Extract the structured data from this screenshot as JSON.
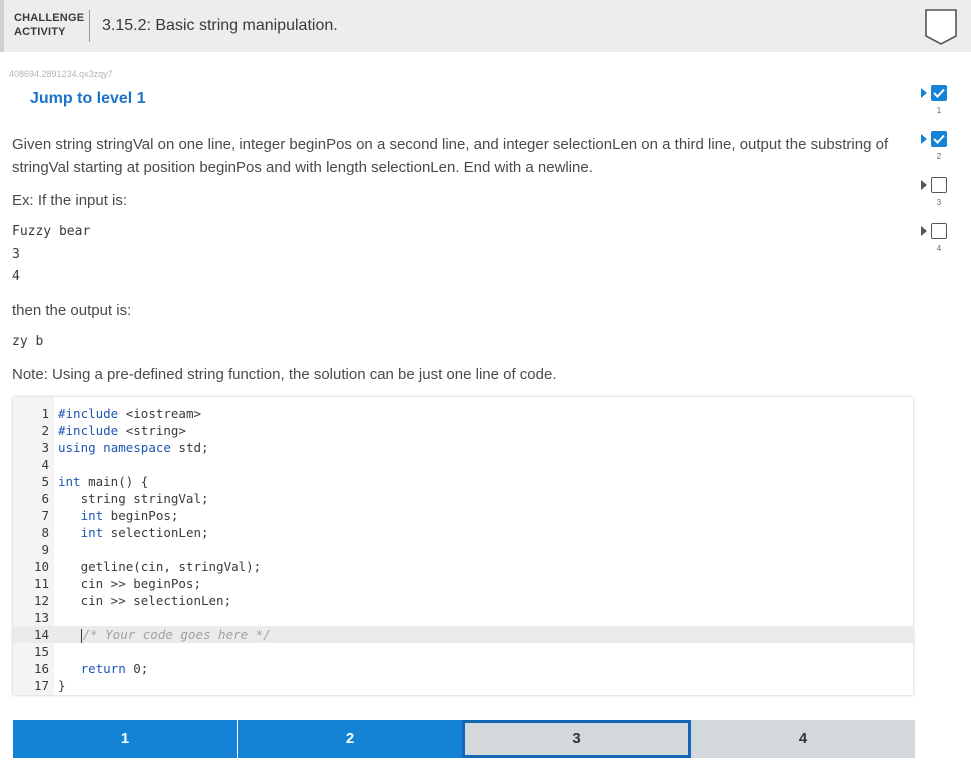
{
  "header": {
    "label_line1": "CHALLENGE",
    "label_line2": "ACTIVITY",
    "title": "3.15.2: Basic string manipulation."
  },
  "activity_id": "408694.2891234.qx3zqy7",
  "jump_link": "Jump to level 1",
  "instructions": {
    "description": "Given string stringVal on one line, integer beginPos on a second line, and integer selectionLen on a third line, output the substring of stringVal starting at position beginPos and with length selectionLen. End with a newline.",
    "example_intro": "Ex: If the input is:",
    "input_lines": [
      "Fuzzy bear",
      "3",
      "4"
    ],
    "output_intro": "then the output is:",
    "output_line": "zy b",
    "note": "Note: Using a pre-defined string function, the solution can be just one line of code."
  },
  "code": {
    "lines": [
      {
        "n": "1",
        "t": "#include <iostream>"
      },
      {
        "n": "2",
        "t": "#include <string>"
      },
      {
        "n": "3",
        "t": "using namespace std;"
      },
      {
        "n": "4",
        "t": ""
      },
      {
        "n": "5",
        "t": "int main() {"
      },
      {
        "n": "6",
        "t": "   string stringVal;"
      },
      {
        "n": "7",
        "t": "   int beginPos;"
      },
      {
        "n": "8",
        "t": "   int selectionLen;"
      },
      {
        "n": "9",
        "t": ""
      },
      {
        "n": "10",
        "t": "   getline(cin, stringVal);"
      },
      {
        "n": "11",
        "t": "   cin >> beginPos;"
      },
      {
        "n": "12",
        "t": "   cin >> selectionLen;"
      },
      {
        "n": "13",
        "t": ""
      },
      {
        "n": "14",
        "t": "   /* Your code goes here */"
      },
      {
        "n": "15",
        "t": ""
      },
      {
        "n": "16",
        "t": "   return 0;"
      },
      {
        "n": "17",
        "t": "}"
      }
    ]
  },
  "levels": {
    "bar": [
      {
        "label": "1",
        "state": "done"
      },
      {
        "label": "2",
        "state": "done"
      },
      {
        "label": "3",
        "state": "current"
      },
      {
        "label": "4",
        "state": "todo"
      }
    ],
    "side": [
      {
        "num": "1",
        "state": "done"
      },
      {
        "num": "2",
        "state": "done"
      },
      {
        "num": "3",
        "state": "todo"
      },
      {
        "num": "4",
        "state": "todo"
      }
    ]
  },
  "colors": {
    "accent": "#1482d5",
    "current_border": "#1368b5",
    "link": "#1a73c8"
  }
}
